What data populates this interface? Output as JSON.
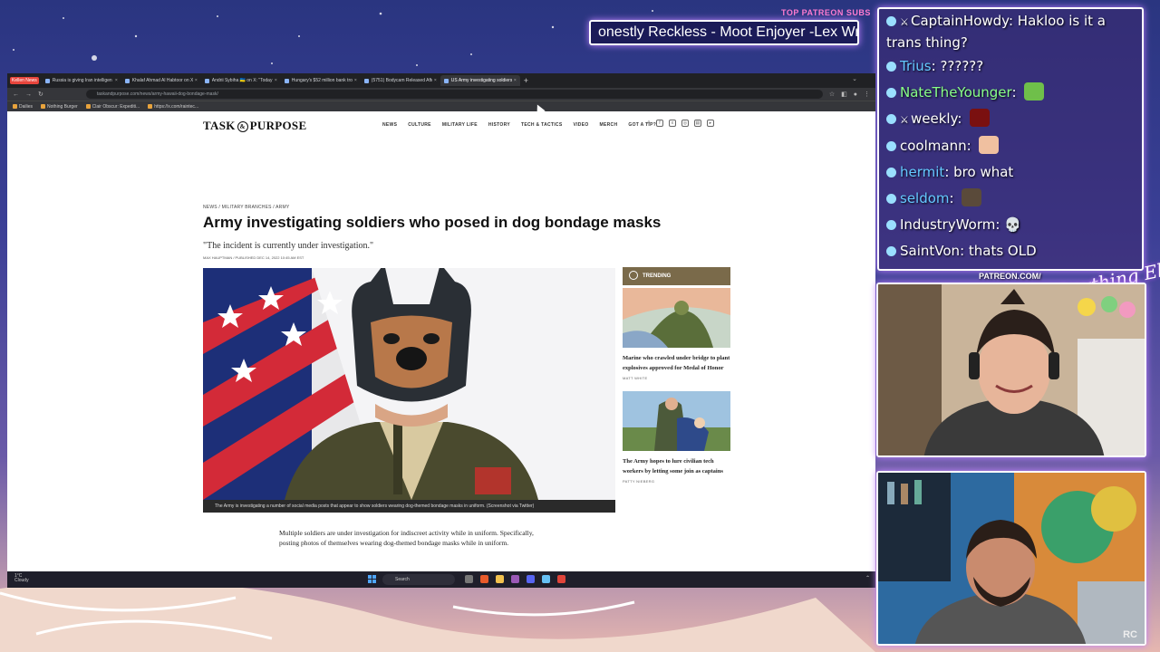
{
  "overlay": {
    "ticker_header": "TOP PATREON SUBS",
    "ticker_text": "onestly Reckless - Moot Enjoyer -Lex Wry",
    "patreon_label": "PATREON.COM/",
    "signature": "Anything Else",
    "cam_watermark": "RC"
  },
  "chat": [
    {
      "user": "CaptainHowdy",
      "text": "Hakloo is it a trans thing?",
      "color": "white",
      "badge": "sword"
    },
    {
      "user": "Trius",
      "text": "??????",
      "color": "blue"
    },
    {
      "user": "NateTheYounger",
      "text": "",
      "color": "green",
      "emote": "frog-emote"
    },
    {
      "user": "weekly",
      "text": "",
      "color": "white",
      "badge": "sword",
      "emote": "orb-emote"
    },
    {
      "user": "coolmann",
      "text": "",
      "color": "white",
      "emote": "blush-emote"
    },
    {
      "user": "hermit",
      "text": "bro what",
      "color": "blue"
    },
    {
      "user": "seldom",
      "text": "",
      "color": "blue",
      "emote": "face-emote"
    },
    {
      "user": "IndustryWorm",
      "text": "💀",
      "color": "white"
    },
    {
      "user": "SaintVon",
      "text": "thats OLD",
      "color": "white"
    }
  ],
  "browser": {
    "pinned": "Kellen News",
    "tabs": [
      "Russia is giving Iran intelligen",
      "Khalaf Ahmad Al Habtoor on X:",
      "Andrii Sybiha 🇺🇦 on X: \"Today a",
      "Hungary's $52 million bank tro",
      "(5751) Bodycam Released After",
      "US Army investigating soldiers"
    ],
    "url": "taskandpurpose.com/news/army-hawaii-dog-bondage-mask/",
    "bookmarks": [
      "Dailies",
      "Nothing Burger",
      "Clair Obscur: Expediti...",
      "https://x.com/raintec..."
    ]
  },
  "site": {
    "logo_left": "TASK",
    "logo_mid": "&",
    "logo_right": "PURPOSE",
    "nav": [
      "NEWS",
      "CULTURE",
      "MILITARY LIFE",
      "HISTORY",
      "TECH & TACTICS",
      "VIDEO",
      "MERCH",
      "GOT A TIP?"
    ],
    "breadcrumb": "NEWS  /  MILITARY BRANCHES  /  ARMY",
    "headline": "Army investigating soldiers who posed in dog bondage masks",
    "dek": "\"The incident is currently under investigation.\"",
    "byline": "MAX HAUPTMAN / PUBLISHED DEC 14, 2022 10:45 AM EST",
    "caption": "The Army is investigating a number of social media posts that appear to show soldiers wearing dog-themed bondage masks in uniform. (Screenshot via Twitter)",
    "body": "Multiple soldiers are under investigation for indiscreet activity while in uniform. Specifically, posting photos of themselves wearing dog-themed bondage masks while in uniform.",
    "trending_label": "TRENDING",
    "trending": [
      {
        "title": "Marine who crawled under bridge to plant explosives approved for Medal of Honor",
        "author": "MATT WHITE"
      },
      {
        "title": "The Army hopes to lure civilian tech workers by letting some join as captains",
        "author": "PATTY NIEBERG"
      }
    ]
  },
  "taskbar": {
    "weather_temp": "1°C",
    "weather_cond": "Cloudy",
    "search_placeholder": "Search"
  }
}
